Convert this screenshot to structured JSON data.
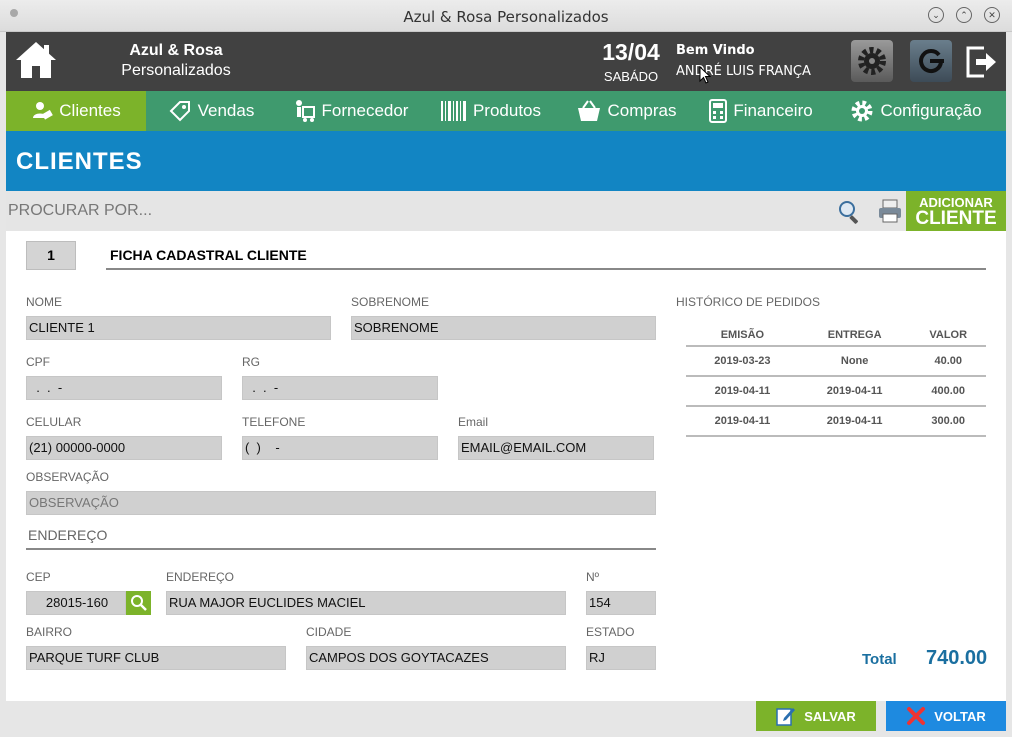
{
  "window": {
    "title": "Azul & Rosa Personalizados",
    "buttons": [
      "⌄",
      "⌃",
      "✕"
    ]
  },
  "header": {
    "brand_line1": "Azul & Rosa",
    "brand_line2": "Personalizados",
    "date": "13/04",
    "weekday": "SABÁDO",
    "welcome": "Bem Vindo",
    "user": "ANDRÉ LUIS FRANÇA"
  },
  "nav": {
    "items": [
      {
        "label": "Clientes",
        "icon": "user-tag-icon",
        "active": true
      },
      {
        "label": "Vendas",
        "icon": "tag-icon",
        "active": false
      },
      {
        "label": "Fornecedor",
        "icon": "cart-man-icon",
        "active": false
      },
      {
        "label": "Produtos",
        "icon": "barcode-icon",
        "active": false
      },
      {
        "label": "Compras",
        "icon": "basket-icon",
        "active": false
      },
      {
        "label": "Financeiro",
        "icon": "calculator-icon",
        "active": false
      },
      {
        "label": "Configuração",
        "icon": "gear-icon",
        "active": false
      }
    ]
  },
  "page": {
    "title": "CLIENTES"
  },
  "search": {
    "placeholder": "PROCURAR POR...",
    "add_line1": "ADICIONAR",
    "add_line2": "CLIENTE"
  },
  "form": {
    "id": "1",
    "title": "FICHA CADASTRAL CLIENTE",
    "nome_label": "NOME",
    "nome": "CLIENTE 1",
    "sobrenome_label": "SOBRENOME",
    "sobrenome": "SOBRENOME",
    "cpf_label": "CPF",
    "cpf": "  .  .  -",
    "rg_label": "RG",
    "rg": "  .  .  -",
    "celular_label": "CELULAR",
    "celular": "(21) 00000-0000",
    "telefone_label": "TELEFONE",
    "telefone": "(  )    -",
    "email_label": "Email",
    "email": "EMAIL@EMAIL.COM",
    "obs_label": "OBSERVAÇÃO",
    "obs_placeholder": "OBSERVAÇÃO",
    "endereco_section": "ENDEREÇO",
    "cep_label": "CEP",
    "cep": "28015-160",
    "endereco_label": "ENDEREÇO",
    "endereco": "RUA MAJOR EUCLIDES MACIEL",
    "numero_label": "Nº",
    "numero": "154",
    "bairro_label": "BAIRRO",
    "bairro": "PARQUE TURF CLUB",
    "cidade_label": "CIDADE",
    "cidade": "CAMPOS DOS GOYTACAZES",
    "estado_label": "ESTADO",
    "estado": "RJ"
  },
  "history": {
    "title": "HISTÓRICO DE PEDIDOS",
    "headers": [
      "EMISÃO",
      "ENTREGA",
      "VALOR"
    ],
    "rows": [
      [
        "2019-03-23",
        "None",
        "40.00"
      ],
      [
        "2019-04-11",
        "2019-04-11",
        "400.00"
      ],
      [
        "2019-04-11",
        "2019-04-11",
        "300.00"
      ]
    ],
    "total_label": "Total",
    "total": "740.00"
  },
  "footer": {
    "save": "SALVAR",
    "back": "VOLTAR"
  },
  "colors": {
    "nav_bg": "#3f9a6e",
    "active": "#7cb32a",
    "banner": "#1285c3",
    "header": "#414141",
    "total": "#1a6fa0",
    "back": "#1e8ae0"
  }
}
